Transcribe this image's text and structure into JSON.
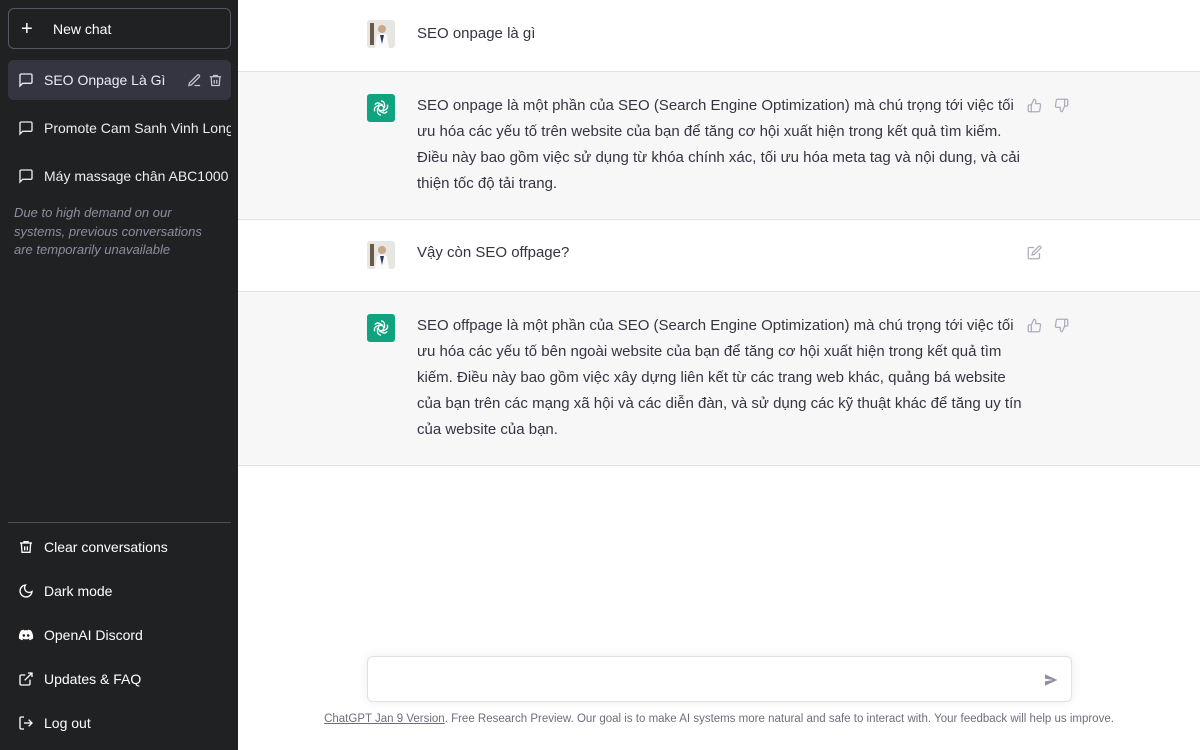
{
  "sidebar": {
    "new_chat_label": "New chat",
    "conversations": [
      {
        "label": "SEO Onpage Là Gì",
        "active": true
      },
      {
        "label": "Promote Cam Sanh Vinh Long"
      },
      {
        "label": "Máy massage chân ABC1000"
      }
    ],
    "notice": "Due to high demand on our systems, previous conversations are temporarily unavailable",
    "menu": [
      {
        "label": "Clear conversations",
        "icon": "trash-icon"
      },
      {
        "label": "Dark mode",
        "icon": "moon-icon"
      },
      {
        "label": "OpenAI Discord",
        "icon": "discord-icon"
      },
      {
        "label": "Updates & FAQ",
        "icon": "external-link-icon"
      },
      {
        "label": "Log out",
        "icon": "logout-icon"
      }
    ]
  },
  "messages": [
    {
      "role": "user",
      "text": "SEO onpage là gì"
    },
    {
      "role": "assistant",
      "text": "SEO onpage là một phần của SEO (Search Engine Optimization) mà chú trọng tới việc tối ưu hóa các yếu tố trên website của bạn để tăng cơ hội xuất hiện trong kết quả tìm kiếm. Điều này bao gồm việc sử dụng từ khóa chính xác, tối ưu hóa meta tag và nội dung, và cải thiện tốc độ tải trang."
    },
    {
      "role": "user",
      "text": "Vậy còn SEO offpage?"
    },
    {
      "role": "assistant",
      "text": "SEO offpage là một phần của SEO (Search Engine Optimization) mà chú trọng tới việc tối ưu hóa các yếu tố bên ngoài website của bạn để tăng cơ hội xuất hiện trong kết quả tìm kiếm. Điều này bao gồm việc xây dựng liên kết từ các trang web khác, quảng bá website của bạn trên các mạng xã hội và các diễn đàn, và sử dụng các kỹ thuật khác để tăng uy tín của website của bạn."
    }
  ],
  "input": {
    "value": "",
    "placeholder": ""
  },
  "footer": {
    "version_link": "ChatGPT Jan 9 Version",
    "text": ". Free Research Preview. Our goal is to make AI systems more natural and safe to interact with. Your feedback will help us improve."
  },
  "colors": {
    "sidebar_bg": "#202123",
    "accent": "#10a37f",
    "assistant_bg": "#f7f7f8"
  }
}
